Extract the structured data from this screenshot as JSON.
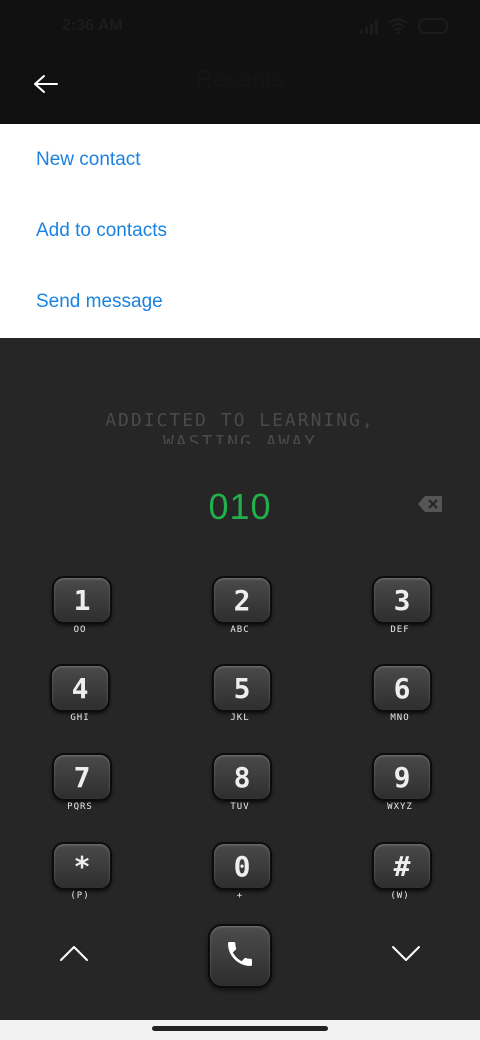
{
  "status_bar": {
    "time": "2:36 AM",
    "icons": [
      "signal-icon",
      "wifi-icon",
      "battery-icon"
    ]
  },
  "header": {
    "title": "Recents",
    "back_icon": "arrow-left-icon"
  },
  "menu": {
    "items": [
      {
        "label": "New contact"
      },
      {
        "label": "Add to contacts"
      },
      {
        "label": "Send message"
      }
    ]
  },
  "tagline": {
    "line1": "ADDICTED TO LEARNING,",
    "line2": "WASTING AWAY"
  },
  "dialer": {
    "number": "010",
    "backspace_icon": "backspace-icon"
  },
  "keypad": {
    "keys": [
      {
        "digit": "1",
        "sub": "OO"
      },
      {
        "digit": "2",
        "sub": "ABC"
      },
      {
        "digit": "3",
        "sub": "DEF"
      },
      {
        "digit": "4",
        "sub": "GHI"
      },
      {
        "digit": "5",
        "sub": "JKL"
      },
      {
        "digit": "6",
        "sub": "MNO"
      },
      {
        "digit": "7",
        "sub": "PQRS"
      },
      {
        "digit": "8",
        "sub": "TUV"
      },
      {
        "digit": "9",
        "sub": "WXYZ"
      },
      {
        "digit": "*",
        "sub": "(P)"
      },
      {
        "digit": "0",
        "sub": "+"
      },
      {
        "digit": "#",
        "sub": "(W)"
      }
    ]
  },
  "bottom": {
    "left_icon": "chevron-up-icon",
    "call_icon": "phone-icon",
    "right_icon": "chevron-down-icon"
  },
  "colors": {
    "accent_blue": "#1a82e0",
    "number_green": "#21b04b",
    "background": "#262626"
  }
}
